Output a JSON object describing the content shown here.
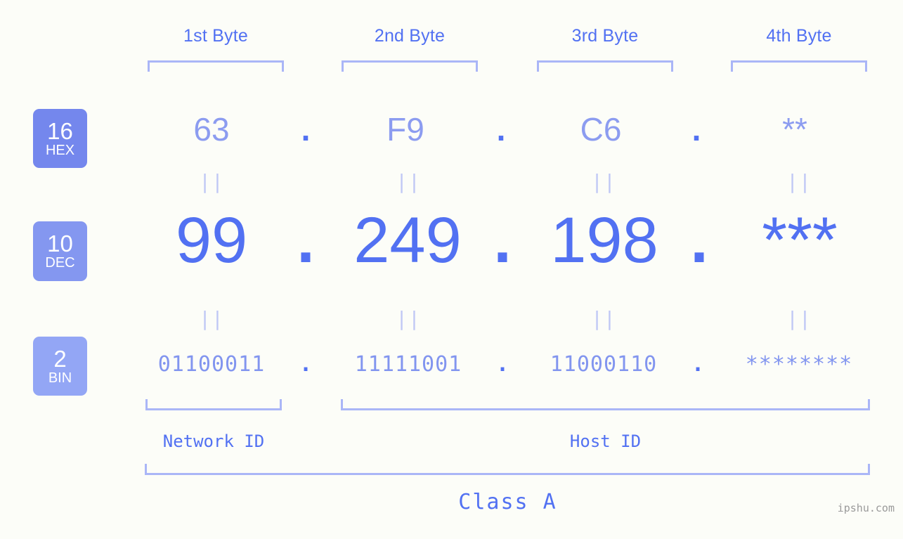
{
  "meta": {
    "background_color": "#fcfdf8",
    "accent_color": "#5271f2",
    "accent_light_color": "#8c9cf0",
    "bracket_color": "#aab6f7",
    "equals_color": "#c0c8f5",
    "watermark": "ipshu.com"
  },
  "headers": {
    "byte1": "1st Byte",
    "byte2": "2nd Byte",
    "byte3": "3rd Byte",
    "byte4": "4th Byte"
  },
  "bases": [
    {
      "number": "16",
      "name": "HEX",
      "color": "#7487ed"
    },
    {
      "number": "10",
      "name": "DEC",
      "color": "#8497f0"
    },
    {
      "number": "2",
      "name": "BIN",
      "color": "#93a6f5"
    }
  ],
  "separator": ".",
  "equals_glyph": "||",
  "rows": {
    "hex": {
      "b1": "63",
      "b2": "F9",
      "b3": "C6",
      "b4": "**"
    },
    "dec": {
      "b1": "99",
      "b2": "249",
      "b3": "198",
      "b4": "***"
    },
    "bin": {
      "b1": "01100011",
      "b2": "11111001",
      "b3": "11000110",
      "b4": "********"
    }
  },
  "footers": {
    "network_id": "Network ID",
    "host_id": "Host ID",
    "class": "Class A"
  }
}
